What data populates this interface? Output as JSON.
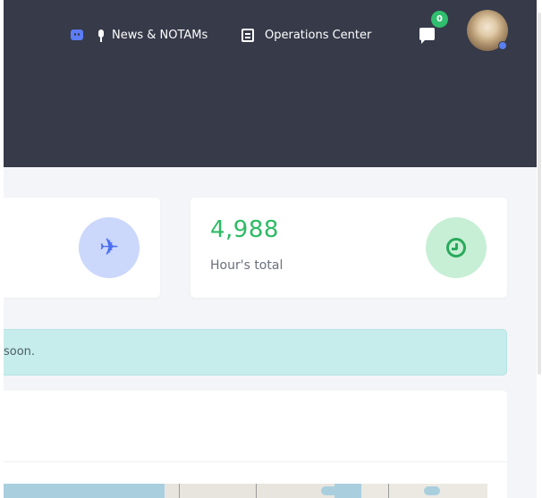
{
  "header": {
    "nav": [
      {
        "label": "",
        "icon": "discord-icon"
      },
      {
        "label": "News & NOTAMs",
        "icon": "microphone-icon"
      },
      {
        "label": "Operations Center",
        "icon": "book-icon"
      }
    ],
    "messages": {
      "icon": "chat-icon",
      "count": "0"
    },
    "user": {
      "icon": "avatar",
      "status_color": "#5a7ff0"
    }
  },
  "stats": {
    "flights": {
      "icon": "plane-icon",
      "icon_color": "#4a6ff0",
      "bg_color": "#cbd7fb"
    },
    "hours": {
      "value": "4,988",
      "label": "Hour's total",
      "icon": "clock-icon",
      "icon_color": "#2aaa5c",
      "bg_color": "#c7efd5"
    }
  },
  "alert": {
    "text": "soon."
  },
  "colors": {
    "topbar": "#363a49",
    "accent_green": "#2dbb64",
    "badge_green": "#2fbf6e",
    "alert_bg": "#c6ecec"
  }
}
